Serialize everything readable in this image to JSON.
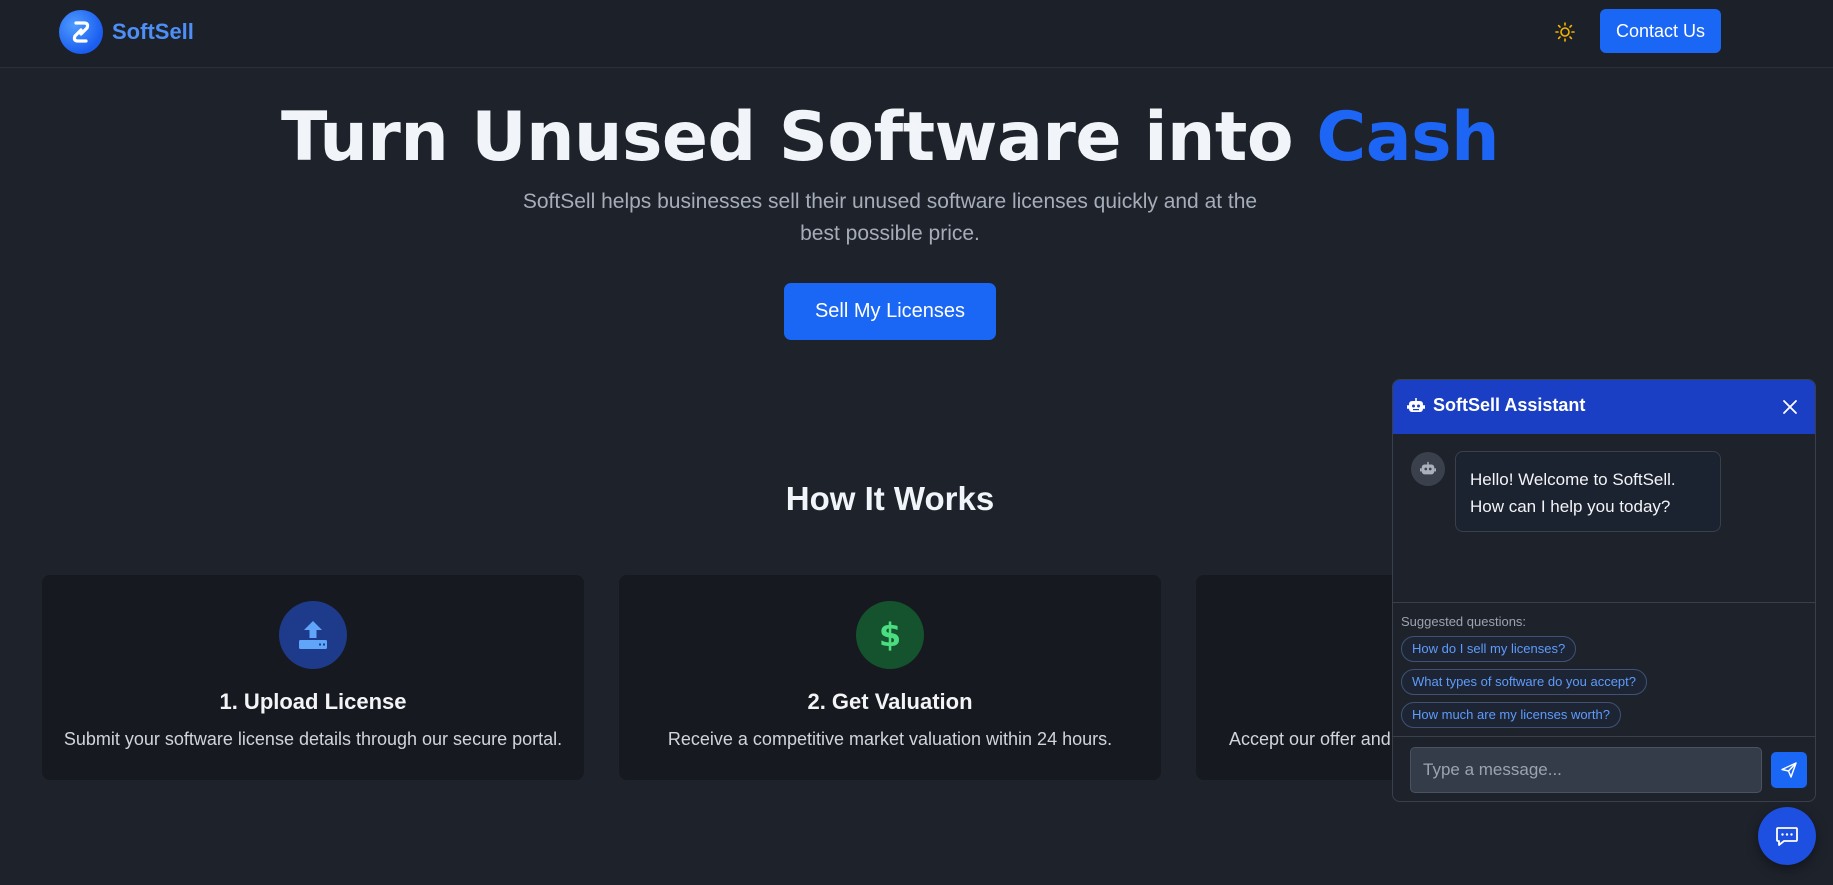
{
  "header": {
    "brand": "SoftSell",
    "contact_label": "Contact Us",
    "theme_icon": "sun-icon"
  },
  "hero": {
    "title_main": "Turn Unused Software into ",
    "title_accent": "Cash",
    "subtitle": "SoftSell helps businesses sell their unused software licenses quickly and at the best possible price.",
    "cta_label": "Sell My Licenses"
  },
  "how_it_works": {
    "title": "How It Works",
    "steps": [
      {
        "title": "1. Upload License",
        "desc": "Submit your software license details through our secure portal.",
        "icon": "upload-icon",
        "color": "#3b82f6"
      },
      {
        "title": "2. Get Valuation",
        "desc": "Receive a competitive market valuation within 24 hours.",
        "icon": "dollar-icon",
        "color": "#22c55e"
      },
      {
        "title": "",
        "desc": "Accept our offer and",
        "icon": "",
        "color": ""
      }
    ]
  },
  "chat": {
    "title": "SoftSell Assistant",
    "welcome": "Hello! Welcome to SoftSell. How can I help you today?",
    "suggested_label": "Suggested questions:",
    "suggestions": [
      "How do I sell my licenses?",
      "What types of software do you accept?",
      "How much are my licenses worth?"
    ],
    "input_placeholder": "Type a message..."
  },
  "colors": {
    "brand": "#1a66f5",
    "background": "#1e222b",
    "chat_header": "#1b3fc4"
  }
}
